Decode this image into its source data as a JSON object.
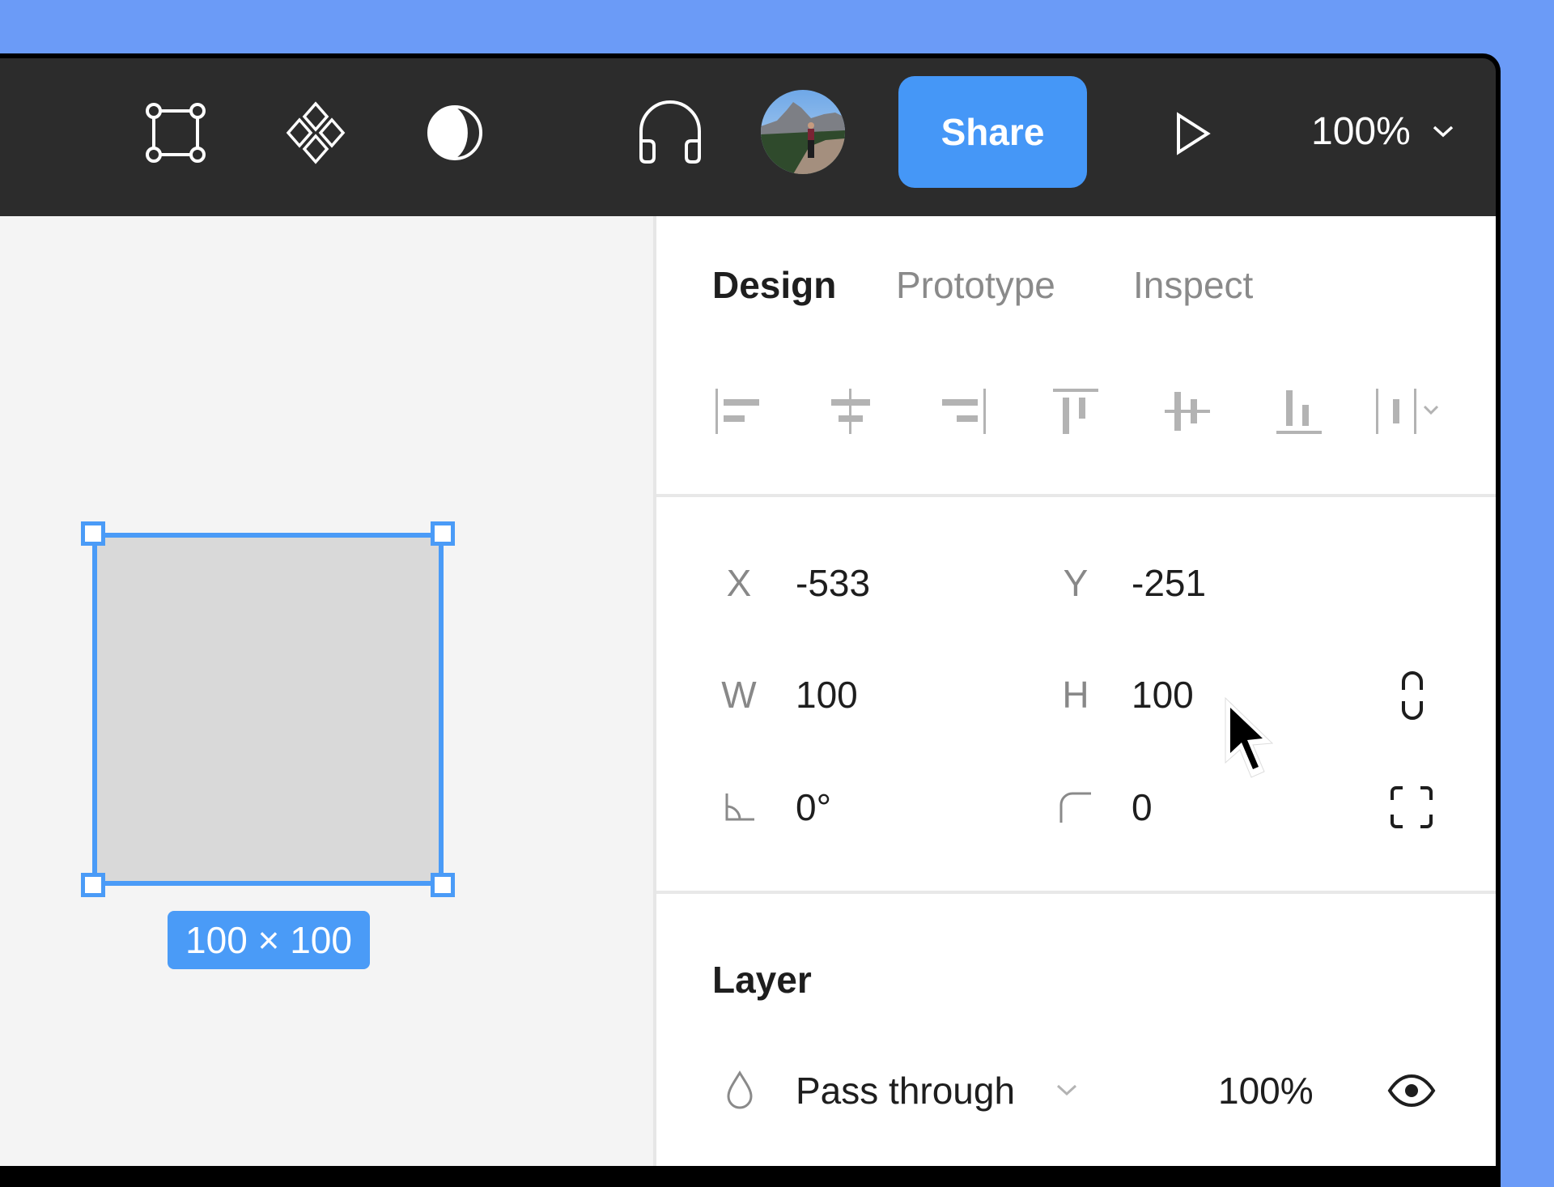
{
  "toolbar": {
    "icons": [
      {
        "name": "frame-tool-icon"
      },
      {
        "name": "components-icon"
      },
      {
        "name": "contrast-theme-icon"
      },
      {
        "name": "audio-headphones-icon"
      }
    ],
    "avatar_alt": "User avatar",
    "share_label": "Share",
    "present_icon": "play-icon",
    "zoom_level": "100%"
  },
  "canvas": {
    "selection_size_label": "100 × 100",
    "accent_color": "#4a9bf7"
  },
  "panel": {
    "tabs": [
      {
        "label": "Design",
        "active": true
      },
      {
        "label": "Prototype",
        "active": false
      },
      {
        "label": "Inspect",
        "active": false
      }
    ],
    "alignment": [
      "align-left",
      "align-horizontal-center",
      "align-right",
      "align-top",
      "align-vertical-center",
      "align-bottom",
      "distribute-spacing"
    ],
    "properties": {
      "x": {
        "label": "X",
        "value": "-533"
      },
      "y": {
        "label": "Y",
        "value": "-251"
      },
      "w": {
        "label": "W",
        "value": "100"
      },
      "h": {
        "label": "H",
        "value": "100"
      },
      "rotation": {
        "value": "0°"
      },
      "corner_radius": {
        "value": "0"
      }
    },
    "layer": {
      "title": "Layer",
      "blend_mode": "Pass through",
      "opacity": "100%"
    }
  },
  "colors": {
    "share_button": "#4597f7",
    "topbar": "#2c2c2c",
    "background": "#6b9bf7"
  }
}
